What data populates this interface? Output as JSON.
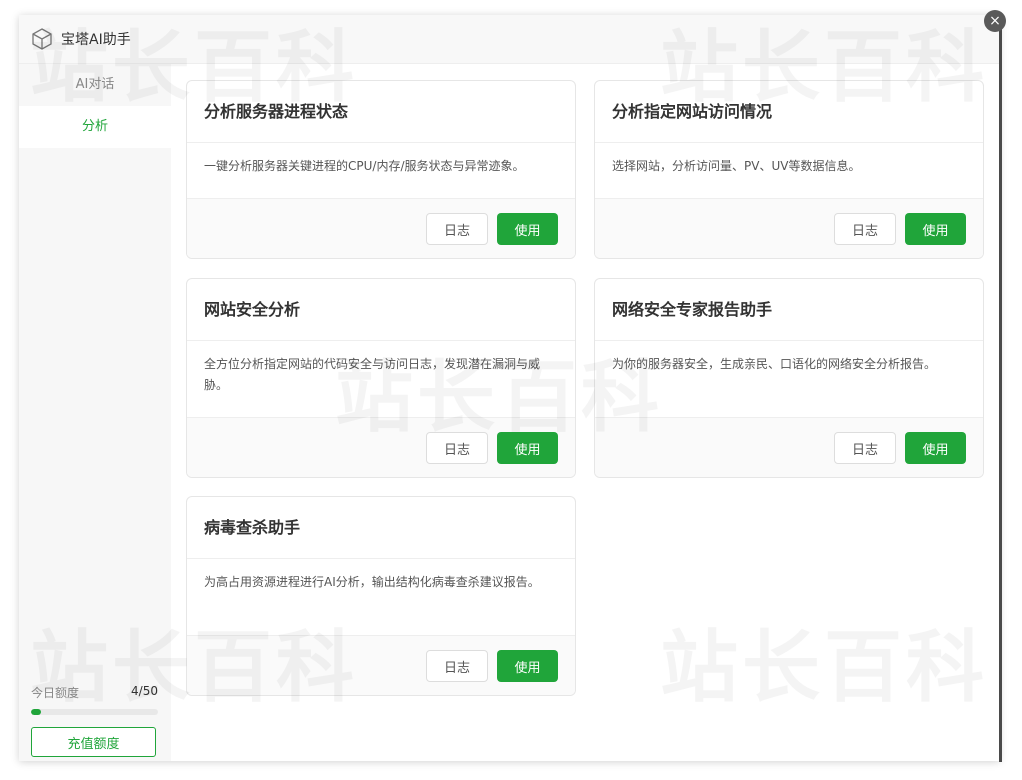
{
  "dialog": {
    "title": "宝塔AI助手",
    "close_glyph": "×"
  },
  "sidebar": {
    "items": [
      {
        "label": "AI对话",
        "active": false
      },
      {
        "label": "分析",
        "active": true
      }
    ],
    "quota": {
      "label": "今日额度",
      "count": "4/50",
      "progress": 0.08
    },
    "recharge_label": "充值额度"
  },
  "cards": [
    {
      "title": "分析服务器进程状态",
      "desc": "一键分析服务器关键进程的CPU/内存/服务状态与异常迹象。",
      "log_label": "日志",
      "use_label": "使用"
    },
    {
      "title": "分析指定网站访问情况",
      "desc": "选择网站，分析访问量、PV、UV等数据信息。",
      "log_label": "日志",
      "use_label": "使用"
    },
    {
      "title": "网站安全分析",
      "desc": "全方位分析指定网站的代码安全与访问日志，发现潜在漏洞与威胁。",
      "log_label": "日志",
      "use_label": "使用"
    },
    {
      "title": "网络安全专家报告助手",
      "desc": "为你的服务器安全，生成亲民、口语化的网络安全分析报告。",
      "log_label": "日志",
      "use_label": "使用"
    },
    {
      "title": "病毒查杀助手",
      "desc": "为高占用资源进程进行AI分析，输出结构化病毒查杀建议报告。",
      "log_label": "日志",
      "use_label": "使用"
    }
  ],
  "watermark": "站长百科",
  "colors": {
    "accent": "#20a53a"
  }
}
